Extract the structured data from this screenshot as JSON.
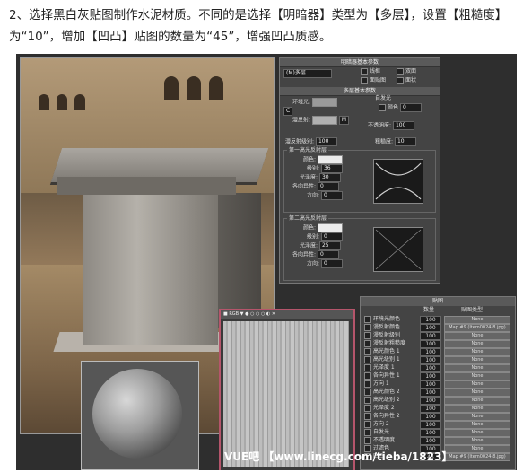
{
  "intro_text": "2、选择黑白灰贴图制作水泥材质。不同的是选择【明暗器】类型为【多层】，设置【粗糙度】为“10”，增加【凹凸】贴图的数量为“45”，增强凹凸质感。",
  "shader_basic": {
    "title": "明暗器基本参数",
    "shader_type": "(M)多层",
    "checks": [
      "线框",
      "双面",
      "面贴图",
      "面状"
    ]
  },
  "multilayer_basic": {
    "title": "多层基本参数",
    "ambient_label": "环境光:",
    "diffuse_label": "漫反射:",
    "self_illum_label": "自发光",
    "color_label": "颜色",
    "color_value": "0",
    "opacity_label": "不透明度:",
    "opacity_value": "100",
    "diffuse_level_label": "漫反射级别:",
    "diffuse_level_value": "100",
    "roughness_label": "粗糙度:",
    "roughness_value": "10",
    "spec1_title": "第一高光反射层",
    "spec1_color_label": "颜色:",
    "spec1_level_label": "级别:",
    "spec1_level_value": "36",
    "spec1_gloss_label": "光泽度:",
    "spec1_gloss_value": "30",
    "spec1_aniso_label": "各向异性:",
    "spec1_aniso_value": "0",
    "spec1_orient_label": "方向:",
    "spec1_orient_value": "0",
    "spec2_title": "第二高光反射层",
    "spec2_color_label": "颜色:",
    "spec2_level_label": "级别:",
    "spec2_level_value": "0",
    "spec2_gloss_label": "光泽度:",
    "spec2_gloss_value": "25",
    "spec2_aniso_label": "各向异性:",
    "spec2_aniso_value": "0",
    "spec2_orient_label": "方向:",
    "spec2_orient_value": "0"
  },
  "maps": {
    "title": "贴图",
    "col_amount": "数量",
    "col_map": "贴图类型",
    "rows": [
      {
        "label": "环境光颜色",
        "amount": "100",
        "map": "None"
      },
      {
        "label": "漫反射颜色",
        "amount": "100",
        "map": "Map #9 (Item0024-8.jpg)"
      },
      {
        "label": "漫反射级别",
        "amount": "100",
        "map": "None"
      },
      {
        "label": "漫反射粗糙度",
        "amount": "100",
        "map": "None"
      },
      {
        "label": "高光颜色 1",
        "amount": "100",
        "map": "None"
      },
      {
        "label": "高光级别 1",
        "amount": "100",
        "map": "None"
      },
      {
        "label": "光泽度 1",
        "amount": "100",
        "map": "None"
      },
      {
        "label": "各向异性 1",
        "amount": "100",
        "map": "None"
      },
      {
        "label": "方向 1",
        "amount": "100",
        "map": "None"
      },
      {
        "label": "高光颜色 2",
        "amount": "100",
        "map": "None"
      },
      {
        "label": "高光级别 2",
        "amount": "100",
        "map": "None"
      },
      {
        "label": "光泽度 2",
        "amount": "100",
        "map": "None"
      },
      {
        "label": "各向异性 2",
        "amount": "100",
        "map": "None"
      },
      {
        "label": "方向 2",
        "amount": "100",
        "map": "None"
      },
      {
        "label": "自发光",
        "amount": "100",
        "map": "None"
      },
      {
        "label": "不透明度",
        "amount": "100",
        "map": "None"
      },
      {
        "label": "过滤色",
        "amount": "100",
        "map": "None"
      },
      {
        "label": "凹凸",
        "amount": "45",
        "map": "Map #9 (Item0024-8.jpg)"
      }
    ]
  },
  "texture_viewer_title": "■ RGB ▼ ● ○ ○ ○ ◐ ✕",
  "watermark": "VUE吧 【www.linecg.com/tieba/1823】",
  "colors": {
    "accent": "#b5556b",
    "panel": "#444444"
  }
}
